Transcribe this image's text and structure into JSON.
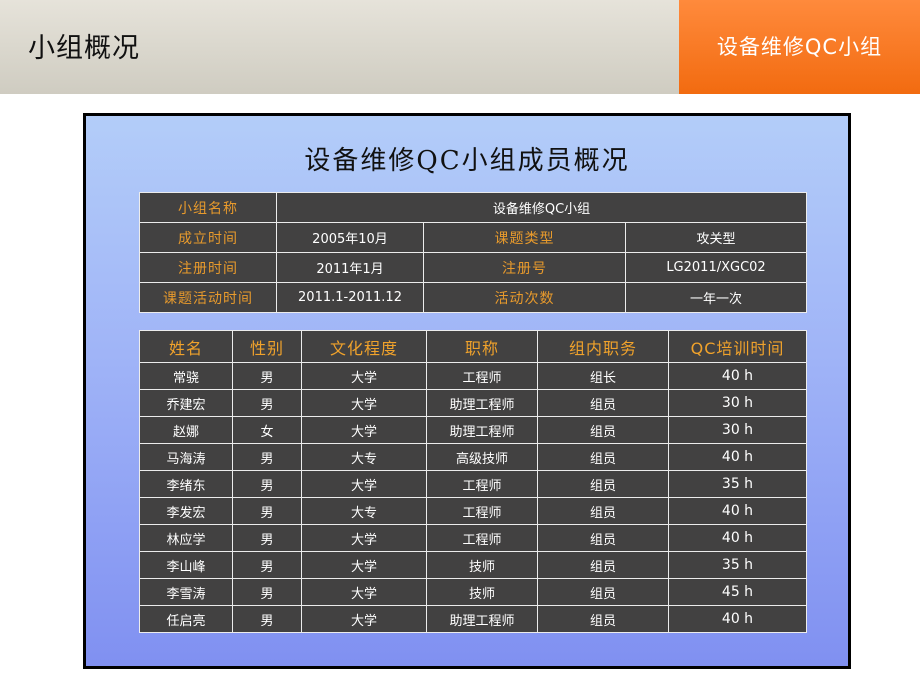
{
  "header": {
    "title": "小组概况",
    "tag": "设备维修QC小组"
  },
  "panel": {
    "title": "设备维修QC小组成员概况"
  },
  "info": {
    "group_name_label": "小组名称",
    "group_name": "设备维修QC小组",
    "founded_label": "成立时间",
    "founded": "2005年10月",
    "topic_type_label": "课题类型",
    "topic_type": "攻关型",
    "registered_label": "注册时间",
    "registered": "2011年1月",
    "reg_no_label": "注册号",
    "reg_no": "LG2011/XGC02",
    "activity_time_label": "课题活动时间",
    "activity_time": "2011.1-2011.12",
    "activity_count_label": "活动次数",
    "activity_count": "一年一次"
  },
  "members": {
    "headers": [
      "姓名",
      "性别",
      "文化程度",
      "职称",
      "组内职务",
      "QC培训时间"
    ],
    "rows": [
      [
        "常骁",
        "男",
        "大学",
        "工程师",
        "组长",
        "40 h"
      ],
      [
        "乔建宏",
        "男",
        "大学",
        "助理工程师",
        "组员",
        "30 h"
      ],
      [
        "赵娜",
        "女",
        "大学",
        "助理工程师",
        "组员",
        "30 h"
      ],
      [
        "马海涛",
        "男",
        "大专",
        "高级技师",
        "组员",
        "40 h"
      ],
      [
        "李绪东",
        "男",
        "大学",
        "工程师",
        "组员",
        "35 h"
      ],
      [
        "李发宏",
        "男",
        "大专",
        "工程师",
        "组员",
        "40 h"
      ],
      [
        "林应学",
        "男",
        "大学",
        "工程师",
        "组员",
        "40 h"
      ],
      [
        "李山峰",
        "男",
        "大学",
        "技师",
        "组员",
        "35 h"
      ],
      [
        "李雪涛",
        "男",
        "大学",
        "技师",
        "组员",
        "45 h"
      ],
      [
        "任启亮",
        "男",
        "大学",
        "助理工程师",
        "组员",
        "40 h"
      ]
    ]
  }
}
